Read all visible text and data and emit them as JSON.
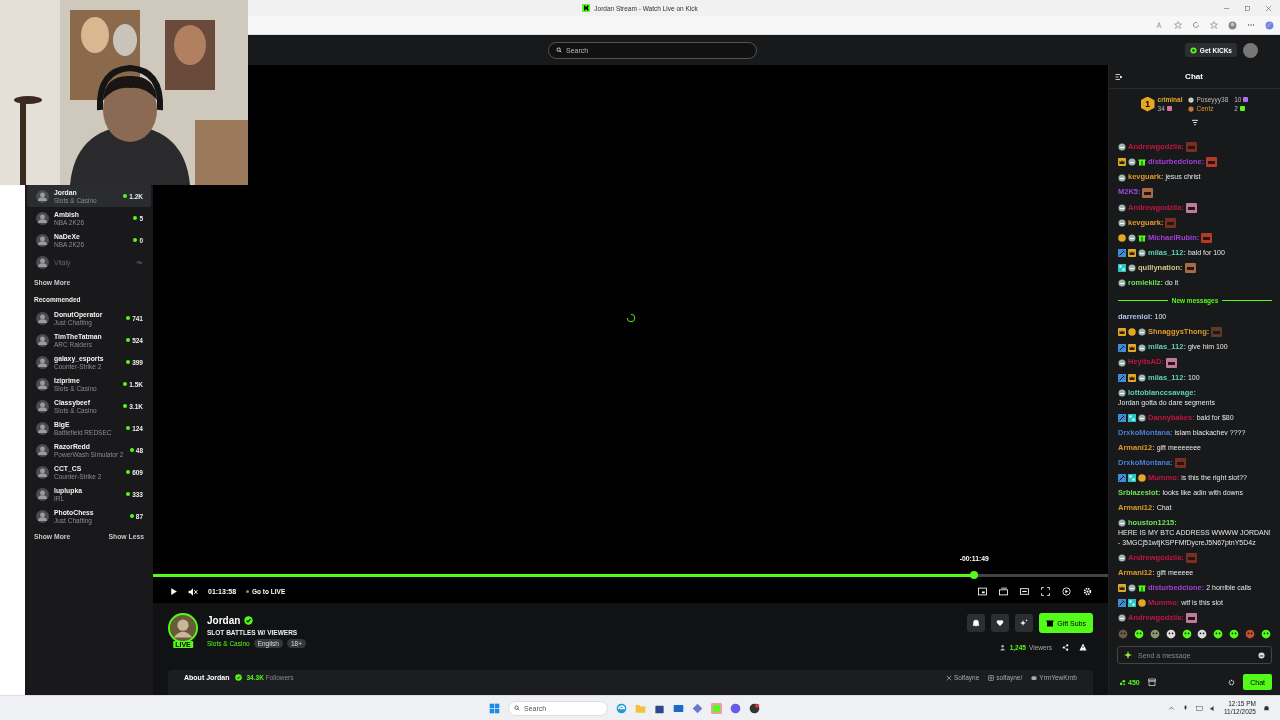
{
  "browser": {
    "title": "Jordan Stream - Watch Live on Kick"
  },
  "navbar": {
    "search_placeholder": "Search",
    "get_kicks": "Get KICKs"
  },
  "sidebar": {
    "following": [
      {
        "name": "Jordan",
        "category": "Slots & Casino",
        "viewers": "1.2K",
        "live": true,
        "selected": true
      },
      {
        "name": "Ambish",
        "category": "NBA 2K26",
        "viewers": "5",
        "live": true,
        "selected": false
      },
      {
        "name": "NaDeXe",
        "category": "NBA 2K26",
        "viewers": "0",
        "live": true,
        "selected": false
      },
      {
        "name": "Vitaly",
        "live": false,
        "selected": false
      }
    ],
    "show_more": "Show More",
    "recommended_title": "Recommended",
    "recommended": [
      {
        "name": "DonutOperator",
        "category": "Just Chatting",
        "viewers": "741",
        "live": true,
        "selected": false
      },
      {
        "name": "TimTheTatman",
        "category": "ARC Raiders",
        "viewers": "524",
        "live": true,
        "selected": false
      },
      {
        "name": "galaxy_esports",
        "category": "Counter-Strike 2",
        "viewers": "399",
        "live": true,
        "selected": false
      },
      {
        "name": "Iziprime",
        "category": "Slots & Casino",
        "viewers": "1.5K",
        "live": true,
        "selected": false
      },
      {
        "name": "Classybeef",
        "category": "Slots & Casino",
        "viewers": "3.1K",
        "live": true,
        "selected": false
      },
      {
        "name": "BigE",
        "category": "Battlefield REDSEC",
        "viewers": "124",
        "live": true,
        "selected": false
      },
      {
        "name": "RazorRedd",
        "category": "PowerWash Simulator 2",
        "viewers": "48",
        "live": true,
        "selected": false
      },
      {
        "name": "CCT_CS",
        "category": "Counter-Strike 2",
        "viewers": "609",
        "live": true,
        "selected": false
      },
      {
        "name": "luplupka",
        "category": "IRL",
        "viewers": "333",
        "live": true,
        "selected": false
      },
      {
        "name": "PhotoChess",
        "category": "Just Chatting",
        "viewers": "87",
        "live": true,
        "selected": false
      }
    ],
    "show_more_2": "Show More",
    "show_less": "Show Less"
  },
  "player": {
    "remaining": "-00:11:49",
    "level": 0.86,
    "time": "01:13:58",
    "go_live": "Go to LIVE",
    "muted": true
  },
  "channel": {
    "name": "Jordan",
    "verified": true,
    "live_badge": "LIVE",
    "title": "SLOT BATTLES W/ VIEWERS",
    "category": "Slots & Casino",
    "tags": [
      "English",
      "18+"
    ],
    "gift_button": "Gift Subs",
    "viewers": "1,245",
    "viewers_label": "Viewers",
    "about": "About Jordan",
    "followers": "34.3K",
    "followers_label": "Followers",
    "socials": [
      {
        "kind": "x",
        "handle": "Solfayne"
      },
      {
        "kind": "instagram",
        "handle": "solfayne/"
      },
      {
        "kind": "discord",
        "handle": "YrmYewKrnb"
      }
    ]
  },
  "chat": {
    "title": "Chat",
    "leaderboard": [
      {
        "rank": "1",
        "name": "criminal",
        "count": "34",
        "color": "#e06fa0"
      },
      {
        "name": "Poseyyy38",
        "count": "10",
        "color": "#a970f0"
      },
      {
        "name": "Centz",
        "count": "2",
        "color": "#53fc18"
      }
    ],
    "messages": [
      {
        "kind": "message",
        "badges": [
          {
            "kind": "sub"
          }
        ],
        "user": "Andrewgodzila:",
        "color": "#c0163f",
        "emote": true
      },
      {
        "kind": "message",
        "badges": [
          {
            "kind": "crown"
          },
          {
            "kind": "sub"
          },
          {
            "kind": "gift"
          }
        ],
        "user": "disturbedclone:",
        "color": "#a43fd9",
        "emote": true
      },
      {
        "kind": "message",
        "badges": [
          {
            "kind": "sub"
          }
        ],
        "user": "kevguark:",
        "color": "#e09a2b",
        "text": "jesus christ",
        "emote": false
      },
      {
        "kind": "message",
        "user": "M2K5:",
        "color": "#9e4be8",
        "emote": true
      },
      {
        "kind": "message",
        "badges": [
          {
            "kind": "sub"
          }
        ],
        "user": "Andrewgodzila:",
        "color": "#c0163f",
        "emote": true
      },
      {
        "kind": "message",
        "badges": [
          {
            "kind": "sub"
          }
        ],
        "user": "kevguark:",
        "color": "#e09a2b",
        "emote": true
      },
      {
        "kind": "message",
        "badges": [
          {
            "kind": "one"
          },
          {
            "kind": "sub"
          },
          {
            "kind": "gift"
          }
        ],
        "user": "MichaelRubin:",
        "color": "#a43fd9",
        "emote": true
      },
      {
        "kind": "message",
        "badges": [
          {
            "kind": "mod"
          },
          {
            "kind": "crown"
          },
          {
            "kind": "sub"
          }
        ],
        "user": "milas_112:",
        "color": "#5fd3b0",
        "text": "bald for 100",
        "emote": false
      },
      {
        "kind": "message",
        "badges": [
          {
            "kind": "vip"
          },
          {
            "kind": "sub"
          }
        ],
        "user": "quillynation:",
        "color": "#d9c38a",
        "emote": true
      },
      {
        "kind": "message",
        "badges": [
          {
            "kind": "sub"
          }
        ],
        "user": "romiekilz:",
        "color": "#6ee05a",
        "text": "do it",
        "emote": false
      },
      {
        "kind": "divider",
        "text": "New messages"
      },
      {
        "kind": "message",
        "user": "darrenlol:",
        "color": "#a9c4f0",
        "text": "100",
        "emote": false
      },
      {
        "kind": "message",
        "badges": [
          {
            "kind": "crown"
          },
          {
            "kind": "one"
          },
          {
            "kind": "sub"
          }
        ],
        "user": "ShnaggysThong:",
        "color": "#e09a2b",
        "emote": true
      },
      {
        "kind": "message",
        "badges": [
          {
            "kind": "mod"
          },
          {
            "kind": "crown"
          },
          {
            "kind": "sub"
          }
        ],
        "user": "milas_112:",
        "color": "#5fd3b0",
        "text": "give him 100",
        "emote": false
      },
      {
        "kind": "message",
        "badges": [
          {
            "kind": "sub"
          }
        ],
        "user": "HeyitsAD:",
        "color": "#c0163f",
        "emote": true
      },
      {
        "kind": "message",
        "badges": [
          {
            "kind": "mod"
          },
          {
            "kind": "crown"
          },
          {
            "kind": "sub"
          }
        ],
        "user": "milas_112:",
        "color": "#5fd3b0",
        "text": "100",
        "emote": false
      },
      {
        "kind": "message",
        "badges": [
          {
            "kind": "sub"
          }
        ],
        "user": "lottoblanccsavage:",
        "color": "#5fd3b0",
        "text": "Jordan gotta do dare segments",
        "emote": false
      },
      {
        "kind": "message",
        "badges": [
          {
            "kind": "mod"
          },
          {
            "kind": "vip"
          },
          {
            "kind": "sub"
          }
        ],
        "user": "Dannybakes:",
        "color": "#c0163f",
        "text": "bald for $80",
        "emote": false
      },
      {
        "kind": "message",
        "user": "DrxkoMontana:",
        "color": "#4a7fd8",
        "text": "islam blackachev ????",
        "emote": false
      },
      {
        "kind": "message",
        "user": "Armani12:",
        "color": "#e09a2b",
        "text": "gift meeeeeee",
        "emote": false
      },
      {
        "kind": "message",
        "user": "DrxkoMontana:",
        "color": "#4a7fd8",
        "emote": true
      },
      {
        "kind": "message",
        "badges": [
          {
            "kind": "mod"
          },
          {
            "kind": "vip"
          },
          {
            "kind": "one"
          }
        ],
        "user": "Mummo:",
        "color": "#c0163f",
        "text": "is this the right slot??",
        "emote": false
      },
      {
        "kind": "message",
        "user": "Srblazeslot:",
        "color": "#6ee05a",
        "text": "looks like adin with downs",
        "emote": false
      },
      {
        "kind": "message",
        "user": "Armani12:",
        "color": "#e09a2b",
        "text": "Chat",
        "emote": false
      },
      {
        "kind": "message",
        "badges": [
          {
            "kind": "sub"
          }
        ],
        "user": "houston1215:",
        "color": "#6ee05a",
        "text": "HERE IS MY BTC ADDRESS WWWW JORDAN! - 3MGCj51wtjKSPFMfDycreJ5N67ptnY5D4z",
        "emote": false
      },
      {
        "kind": "message",
        "badges": [
          {
            "kind": "sub"
          }
        ],
        "user": "Andrewgodzila:",
        "color": "#c0163f",
        "emote": true
      },
      {
        "kind": "message",
        "user": "Armani12:",
        "color": "#e09a2b",
        "text": "gift meeeee",
        "emote": false
      },
      {
        "kind": "message",
        "badges": [
          {
            "kind": "crown"
          },
          {
            "kind": "sub"
          },
          {
            "kind": "gift"
          }
        ],
        "user": "disturbedclone:",
        "color": "#a43fd9",
        "text": "2 horrible calls",
        "emote": false
      },
      {
        "kind": "message",
        "badges": [
          {
            "kind": "mod"
          },
          {
            "kind": "vip"
          },
          {
            "kind": "one"
          }
        ],
        "user": "Mummo:",
        "color": "#c0163f",
        "text": "wtf is this slot",
        "emote": false
      },
      {
        "kind": "message",
        "badges": [
          {
            "kind": "sub"
          }
        ],
        "user": "Andrewgodzila:",
        "color": "#c0163f",
        "emote": true
      }
    ],
    "compose_placeholder": "Send a message",
    "kicks": "450",
    "chat_button": "Chat"
  },
  "taskbar": {
    "search_placeholder": "Search",
    "time": "12:15 PM",
    "date": "11/12/2025"
  }
}
